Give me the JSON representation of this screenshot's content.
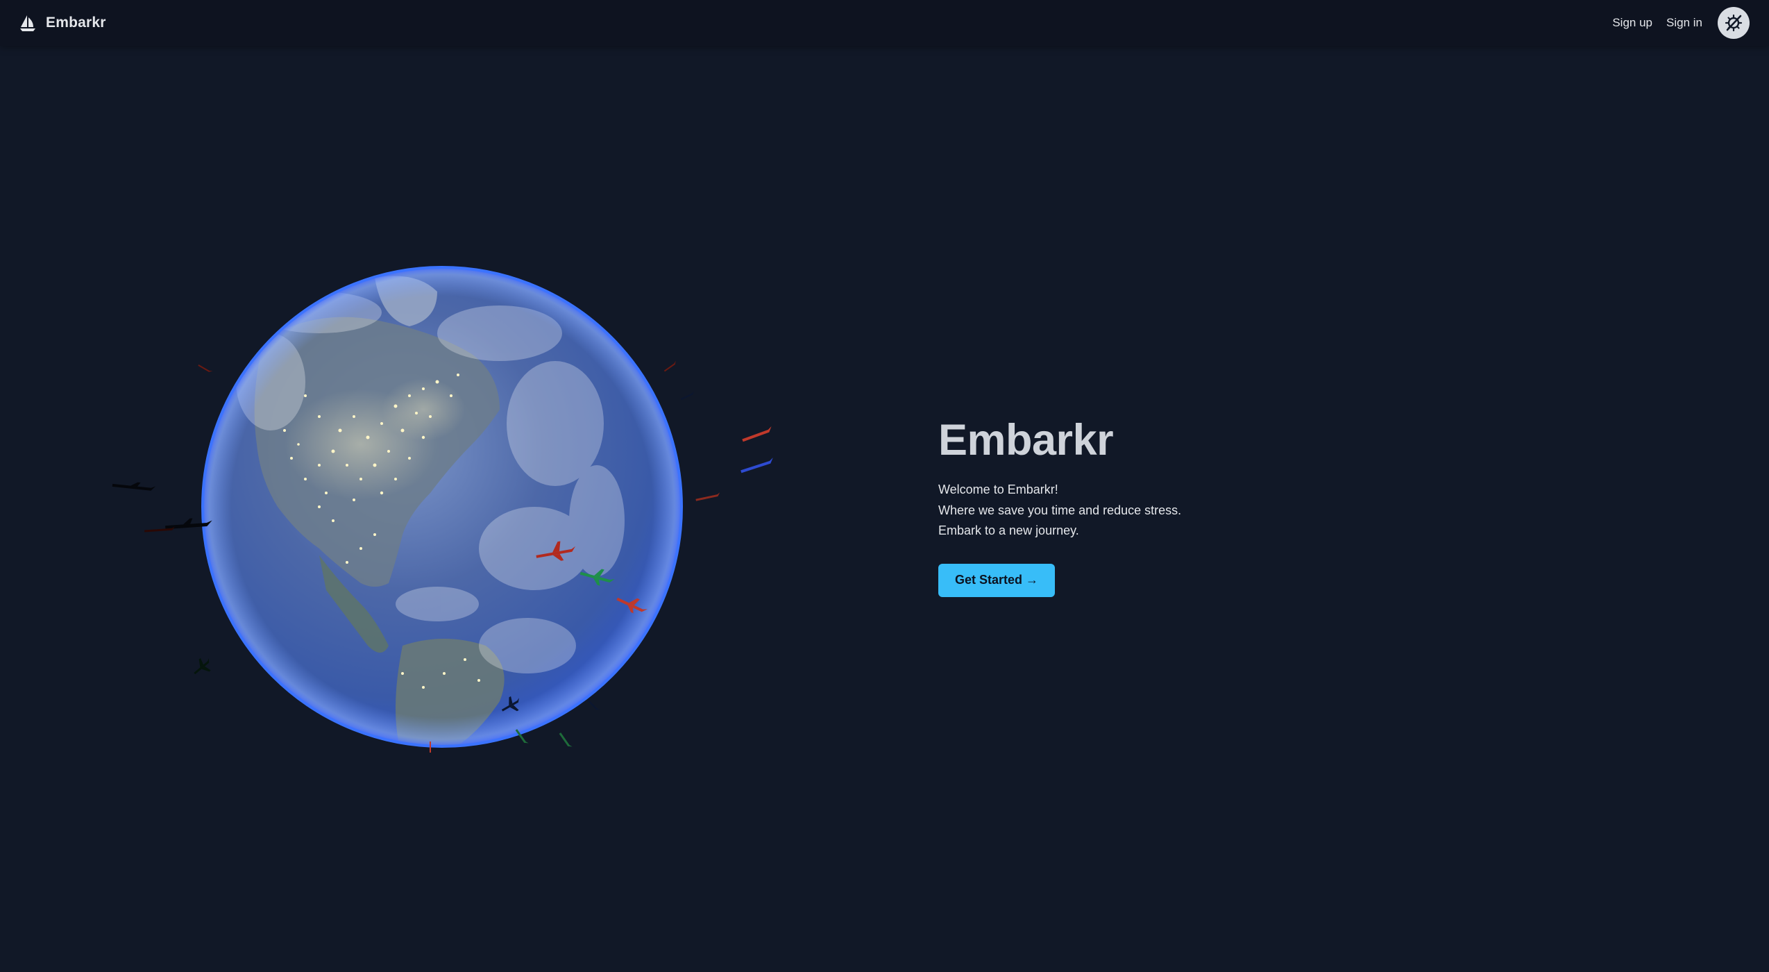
{
  "brand": {
    "name": "Embarkr",
    "icon": "sailboat-icon"
  },
  "nav": {
    "signup_label": "Sign up",
    "signin_label": "Sign in",
    "theme_toggle_icon": "theme-toggle-icon"
  },
  "hero": {
    "title": "Embarkr",
    "lines": [
      "Welcome to Embarkr!",
      "Where we save you time and reduce stress.",
      "Embark to a new journey."
    ],
    "cta_label": "Get Started →"
  },
  "globe": {
    "icon": "earth-globe-with-airplanes"
  },
  "colors": {
    "background": "#111827",
    "navbar": "#0e1320",
    "accent": "#38bdf8",
    "globe_rim": "#3b73ff"
  }
}
